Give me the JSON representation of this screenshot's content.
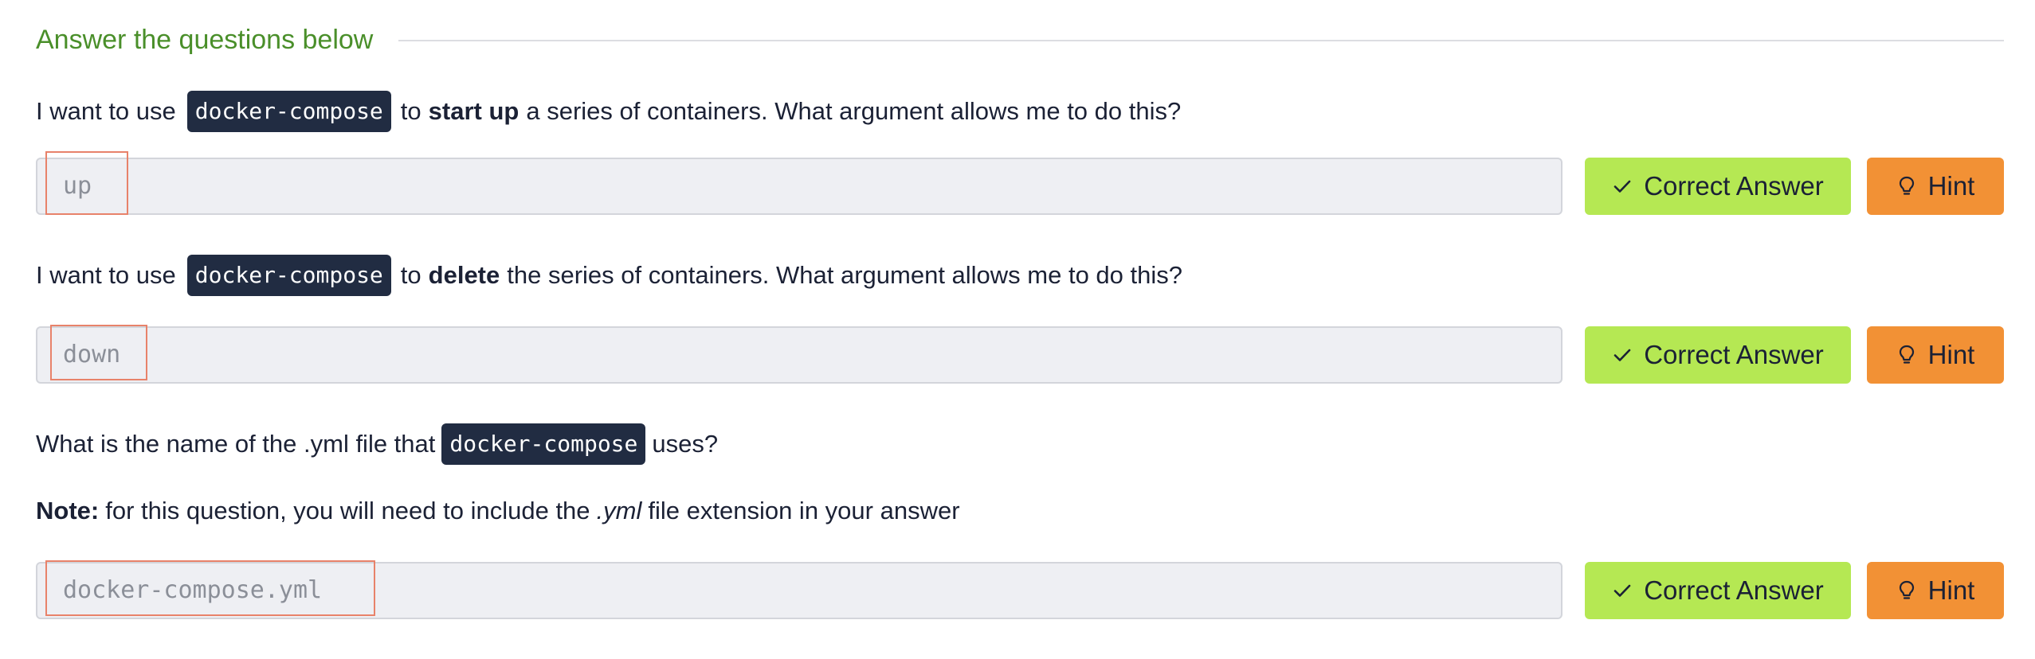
{
  "section": {
    "title": "Answer the questions below"
  },
  "questions": [
    {
      "parts": {
        "before": "I want to use",
        "code": "docker-compose",
        "middle": "to",
        "bold": "start up",
        "after": "a series of containers. What argument allows me to do this?"
      },
      "answer": "up",
      "correct_label": "Correct Answer",
      "hint_label": "Hint"
    },
    {
      "parts": {
        "before": "I want to use",
        "code": "docker-compose",
        "middle": "to",
        "bold": "delete",
        "after": "the series of containers. What argument allows me to do this?"
      },
      "answer": "down",
      "correct_label": "Correct Answer",
      "hint_label": "Hint"
    },
    {
      "parts": {
        "before": "What is the name of the .yml file that",
        "code": "docker-compose",
        "after": "uses?"
      },
      "note": {
        "label": "Note:",
        "text_before": "for this question, you will need to include the",
        "italic": ".yml",
        "text_after": "file extension in your answer"
      },
      "answer": "docker-compose.yml",
      "correct_label": "Correct Answer",
      "hint_label": "Hint"
    }
  ],
  "colors": {
    "section_title": "#4a8f2a",
    "code_bg": "#212c42",
    "correct_bg": "#b5e853",
    "hint_bg": "#f29135",
    "field_bg": "#eeeff3",
    "highlight": "#e8826a"
  },
  "icons": {
    "correct": "check-icon",
    "hint": "lightbulb-icon"
  }
}
